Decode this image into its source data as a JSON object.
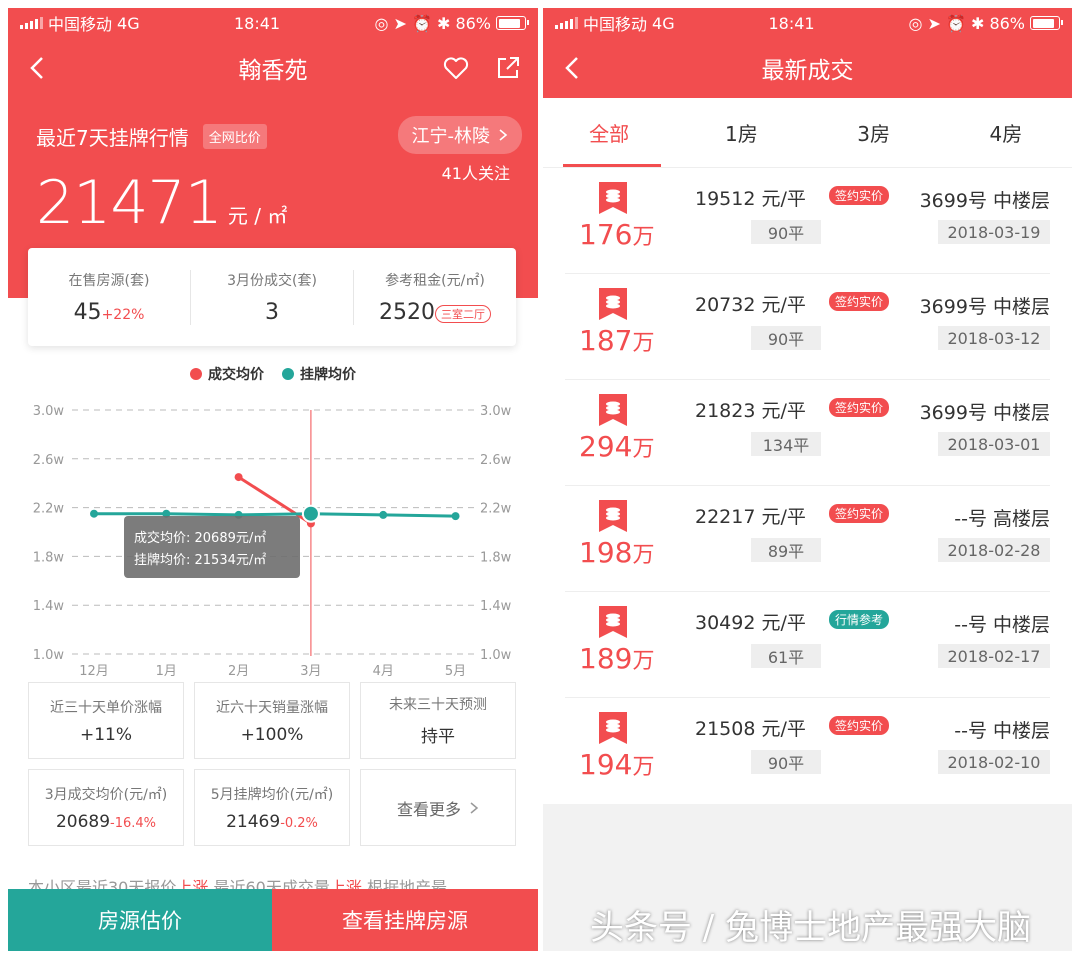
{
  "status_bar": {
    "carrier": "中国移动",
    "network": "4G",
    "time": "18:41",
    "battery": "86%",
    "battery_level": 0.86
  },
  "left": {
    "title": "翰香苑",
    "market_label": "最近7天挂牌行情",
    "compare_tag": "全网比价",
    "area": "江宁-林陵",
    "followers": "41人关注",
    "price": "21471",
    "price_unit": "元 / ㎡",
    "stats": [
      {
        "label": "在售房源(套)",
        "value": "45",
        "change": "+22%"
      },
      {
        "label": "3月份成交(套)",
        "value": "3",
        "change": ""
      },
      {
        "label": "参考租金(元/㎡)",
        "value": "2520",
        "badge": "三室二厅"
      }
    ],
    "metrics": [
      {
        "label": "近三十天单价涨幅",
        "value": "+11%",
        "change": ""
      },
      {
        "label": "近六十天销量涨幅",
        "value": "+100%",
        "change": ""
      },
      {
        "label": "未来三十天预测",
        "value": "持平",
        "change": ""
      },
      {
        "label": "3月成交均价(元/㎡)",
        "value": "20689",
        "change": "-16.4%"
      },
      {
        "label": "5月挂牌均价(元/㎡)",
        "value": "21469",
        "change": "-0.2%"
      }
    ],
    "more_label": "查看更多",
    "footnote": {
      "p1": "本小区最近30天报价",
      "h1": "上涨",
      "p2": " 最近60天成交量",
      "h2": "上涨",
      "p3": " 根据地产最"
    },
    "btn_estimate": "房源估价",
    "btn_listings": "查看挂牌房源"
  },
  "chart_data": {
    "type": "line",
    "x": [
      "12月",
      "1月",
      "2月",
      "3月",
      "4月",
      "5月"
    ],
    "series": [
      {
        "name": "成交均价",
        "color": "#f24d4f",
        "values": [
          null,
          null,
          2.45,
          2.07,
          null,
          null
        ]
      },
      {
        "name": "挂牌均价",
        "color": "#24a69a",
        "values": [
          2.15,
          2.15,
          2.14,
          2.15,
          2.14,
          2.13
        ]
      }
    ],
    "y_ticks": [
      "1.0w",
      "1.4w",
      "1.8w",
      "2.2w",
      "2.6w",
      "3.0w"
    ],
    "ylim": [
      1.0,
      3.0
    ],
    "tooltip": {
      "line1": "成交均价: 20689元/㎡",
      "line2": "挂牌均价: 21534元/㎡",
      "index": 3
    },
    "grid": true,
    "legend": "top"
  },
  "right": {
    "title": "最新成交",
    "tabs": [
      "全部",
      "1房",
      "3房",
      "4房"
    ],
    "deals": [
      {
        "total": "176",
        "wan": "万",
        "unit_price": "19512 元/平",
        "badge": "签约实价",
        "kind": "sign",
        "area": "90平",
        "building": "3699号 中楼层",
        "date": "2018-03-19"
      },
      {
        "total": "187",
        "wan": "万",
        "unit_price": "20732 元/平",
        "badge": "签约实价",
        "kind": "sign",
        "area": "90平",
        "building": "3699号 中楼层",
        "date": "2018-03-12"
      },
      {
        "total": "294",
        "wan": "万",
        "unit_price": "21823 元/平",
        "badge": "签约实价",
        "kind": "sign",
        "area": "134平",
        "building": "3699号 中楼层",
        "date": "2018-03-01"
      },
      {
        "total": "198",
        "wan": "万",
        "unit_price": "22217 元/平",
        "badge": "签约实价",
        "kind": "sign",
        "area": "89平",
        "building": "--号 高楼层",
        "date": "2018-02-28"
      },
      {
        "total": "189",
        "wan": "万",
        "unit_price": "30492 元/平",
        "badge": "行情参考",
        "kind": "ref",
        "area": "61平",
        "building": "--号 中楼层",
        "date": "2018-02-17"
      },
      {
        "total": "194",
        "wan": "万",
        "unit_price": "21508 元/平",
        "badge": "签约实价",
        "kind": "sign",
        "area": "90平",
        "building": "--号 中楼层",
        "date": "2018-02-10"
      }
    ]
  },
  "watermark": "头条号 / 兔博士地产最强大脑"
}
